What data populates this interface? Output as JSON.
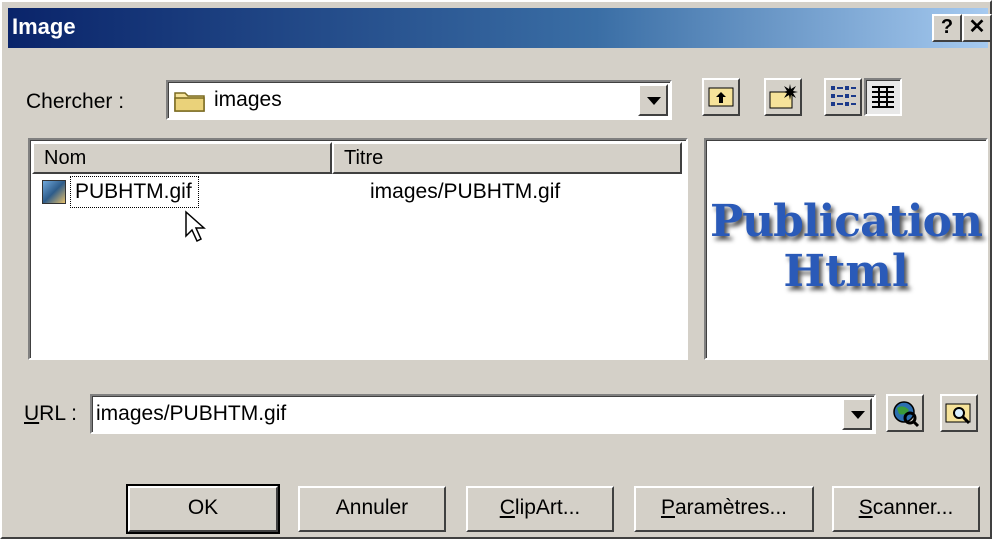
{
  "window": {
    "title": "Image",
    "help_glyph": "?",
    "close_glyph": "✕"
  },
  "lookin": {
    "label": "Chercher :",
    "value": "images"
  },
  "list": {
    "columns": [
      "Nom",
      "Titre"
    ],
    "rows": [
      {
        "name": "PUBHTM.gif",
        "title": "images/PUBHTM.gif"
      }
    ]
  },
  "preview": {
    "line1": "Publication",
    "line2": "Html"
  },
  "url": {
    "label_prefix": "",
    "label_underlined": "U",
    "label_rest": "RL :",
    "value": "images/PUBHTM.gif"
  },
  "buttons": {
    "ok": "OK",
    "cancel": "Annuler",
    "clipart_ul": "C",
    "clipart_rest": "lipArt...",
    "params_ul": "P",
    "params_rest": "aramètres...",
    "scanner_ul": "S",
    "scanner_rest": "canner..."
  },
  "icons": {
    "up_folder": "up-folder-icon",
    "new_folder": "new-folder-icon",
    "list_view": "list-view-icon",
    "details_view": "details-view-icon",
    "browse_web": "browse-web-icon",
    "browse_file": "browse-file-icon"
  }
}
